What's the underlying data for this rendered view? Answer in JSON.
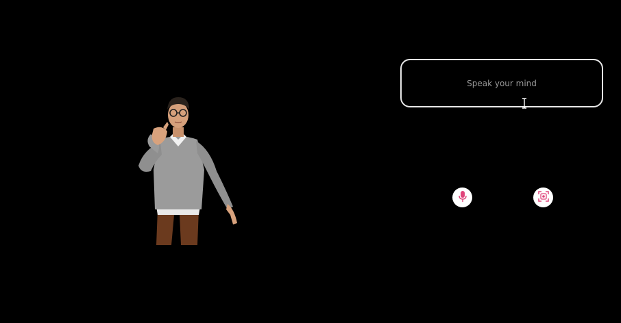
{
  "input": {
    "placeholder": "Speak your mind",
    "value": ""
  },
  "buttons": {
    "mic_icon": "microphone-icon",
    "cam_icon": "camera-frame-icon"
  },
  "colors": {
    "background": "#000000",
    "input_border": "#e8e8e8",
    "accent": "#e0457b",
    "button_bg": "#ffffff"
  }
}
